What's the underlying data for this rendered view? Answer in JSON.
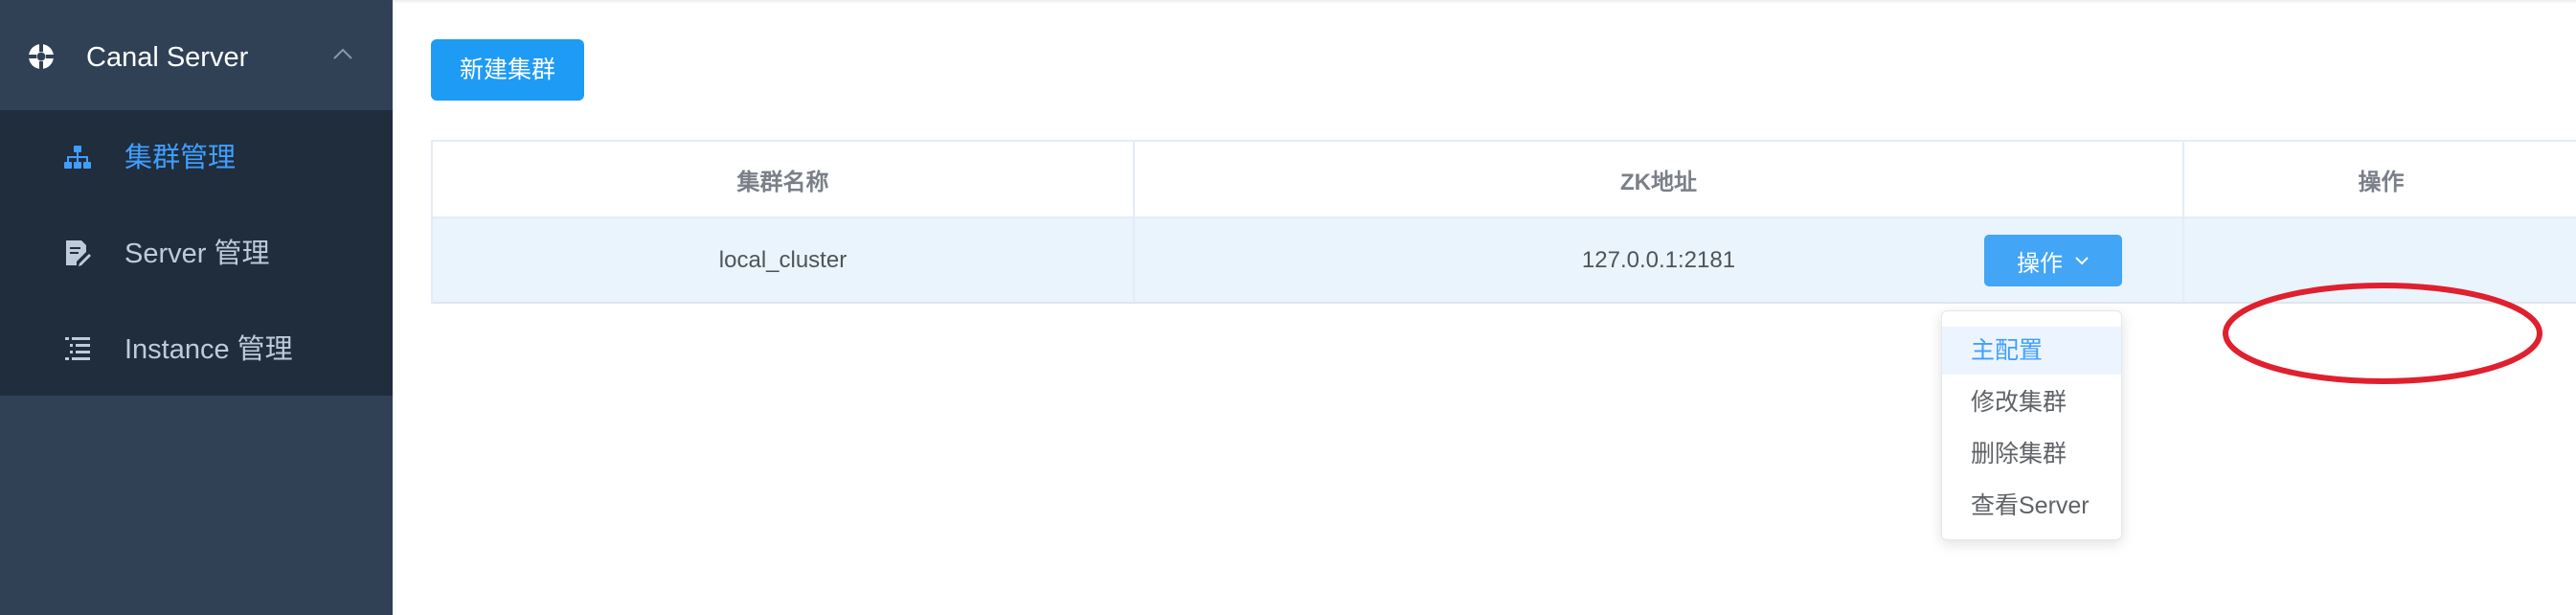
{
  "sidebar": {
    "header": {
      "title": "Canal Server",
      "icon": "compass-icon",
      "arrow": "chevron-up-icon"
    },
    "items": [
      {
        "label": "集群管理",
        "icon": "sitemap-icon",
        "active": true
      },
      {
        "label": "Server 管理",
        "icon": "document-edit-icon",
        "active": false
      },
      {
        "label": "Instance 管理",
        "icon": "list-indent-icon",
        "active": false
      }
    ]
  },
  "toolbar": {
    "new_label": "新建集群"
  },
  "table": {
    "columns": [
      "集群名称",
      "ZK地址",
      "操作"
    ],
    "rows": [
      {
        "name": "local_cluster",
        "zk": "127.0.0.1:2181",
        "action_label": "操作"
      }
    ]
  },
  "dropdown": {
    "items": [
      "主配置",
      "修改集群",
      "删除集群",
      "查看Server"
    ],
    "highlighted": "主配置"
  },
  "colors": {
    "sidebar_bg": "#304156",
    "submenu_bg": "#1f2d3d",
    "active_text": "#409eff",
    "primary": "#1e9bf5",
    "row_highlight": "#e9f4fd",
    "annotation": "#e0202e"
  }
}
